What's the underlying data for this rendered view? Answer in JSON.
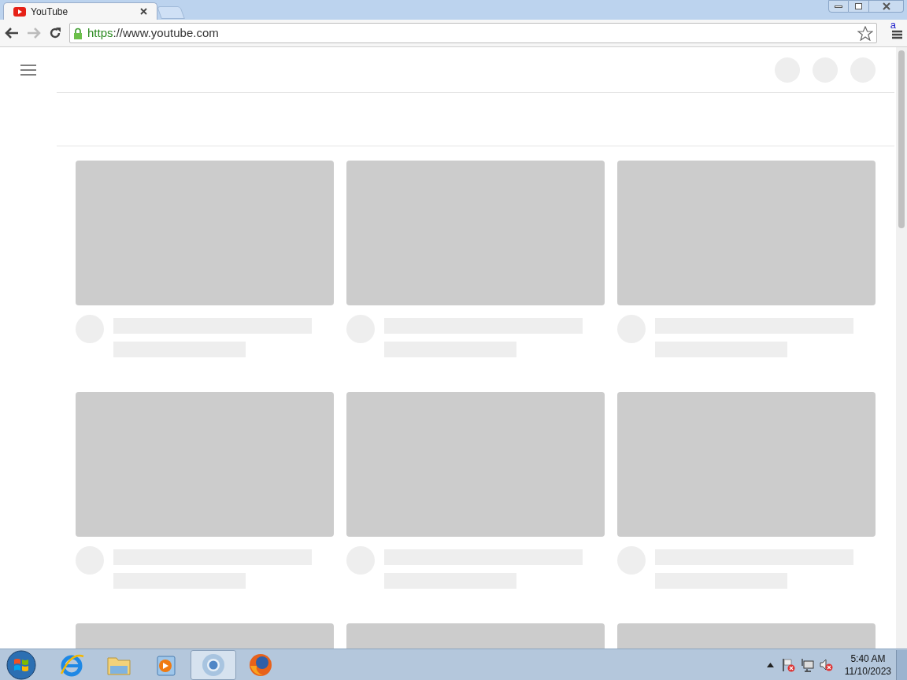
{
  "browser": {
    "tabs": [
      {
        "title": "YouTube",
        "selected": true
      }
    ],
    "address_bar": {
      "secure": true,
      "scheme": "https",
      "rest": "://www.youtube.com"
    },
    "extension_badge": "a"
  },
  "page": {
    "feed": [
      {
        "kind": "placeholder"
      },
      {
        "kind": "placeholder"
      },
      {
        "kind": "placeholder"
      },
      {
        "kind": "placeholder"
      },
      {
        "kind": "placeholder"
      },
      {
        "kind": "placeholder"
      },
      {
        "kind": "thumbnail_only"
      },
      {
        "kind": "thumbnail_only"
      },
      {
        "kind": "thumbnail_only"
      }
    ]
  },
  "taskbar": {
    "apps": [
      {
        "kind": "browser-e",
        "selected": false
      },
      {
        "kind": "folder",
        "selected": false
      },
      {
        "kind": "media",
        "selected": false
      },
      {
        "kind": "chrome",
        "selected": true
      },
      {
        "kind": "firefox",
        "selected": false
      }
    ],
    "clock": {
      "time": "5:40 AM",
      "date": "11/10/2023"
    }
  }
}
